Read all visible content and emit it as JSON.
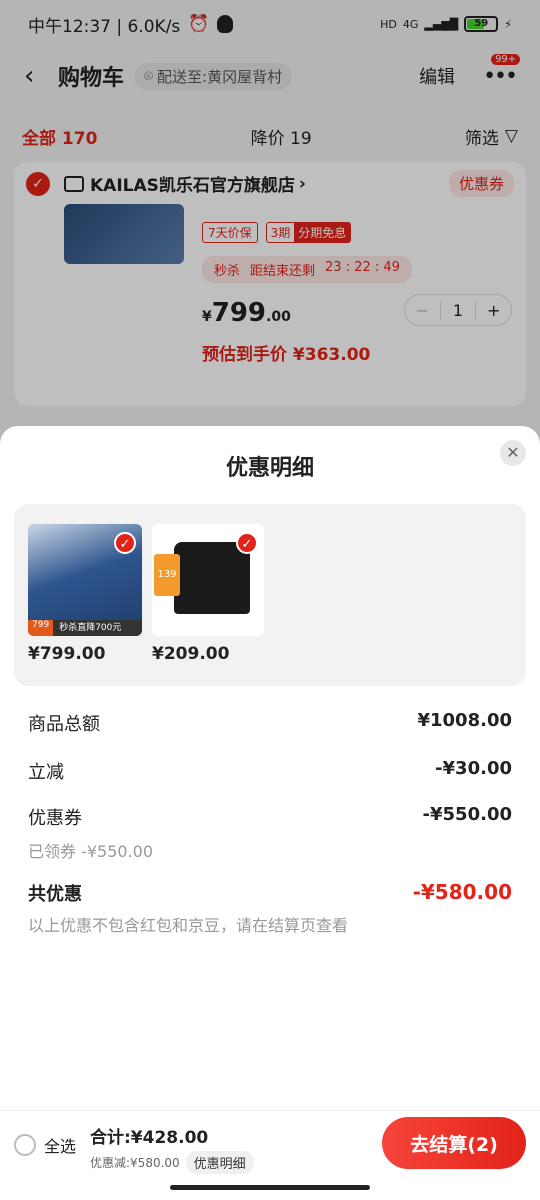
{
  "status_bar": {
    "time_speed": "中午12:37 | 6.0K/s",
    "hd": "HD",
    "network": "4G",
    "battery": "59"
  },
  "nav": {
    "back_icon": "chevron-left-icon",
    "title": "购物车",
    "address": "配送至:黄冈屋背村",
    "edit": "编辑",
    "more_badge": "99+"
  },
  "filter": {
    "all_label": "全部",
    "all_count": "170",
    "price_drop_label": "降价",
    "price_drop_count": "19",
    "filter_label": "筛选"
  },
  "store": {
    "name": "KAILAS凯乐石官方旗舰店",
    "chevron": "›",
    "coupon": "优惠券",
    "tag_price_protect": "7天价保",
    "tag_installment_a": "3期",
    "tag_installment_b": "分期免息",
    "flash_label": "秒杀",
    "flash_countdown_label": "距结束还剩",
    "countdown": "23 : 22 : 49",
    "price_symbol": "¥",
    "price_int": "799",
    "price_dec": ".00",
    "quantity": "1",
    "minus": "−",
    "plus": "+",
    "estimate": "预估到手价 ¥363.00"
  },
  "sheet": {
    "title": "优惠明细",
    "close_icon": "close-icon",
    "products": [
      {
        "price": "¥799.00",
        "badge_price": "799",
        "badge_text": "秒杀直降700元"
      },
      {
        "price": "¥209.00",
        "tag": "139"
      }
    ],
    "rows": {
      "subtotal_label": "商品总额",
      "subtotal_value": "¥1008.00",
      "instant_label": "立减",
      "instant_value": "-¥30.00",
      "coupon_label": "优惠券",
      "coupon_value": "-¥550.00",
      "coupon_sub": "已领券 -¥550.00",
      "total_label": "共优惠",
      "total_value": "-¥580.00",
      "note": "以上优惠不包含红包和京豆，请在结算页查看"
    }
  },
  "checkout": {
    "select_all": "全选",
    "sum": "合计:¥428.00",
    "discount": "优惠减:¥580.00",
    "detail_chip": "优惠明细",
    "button": "去结算(2)"
  },
  "colors": {
    "accent": "#e2231a"
  }
}
